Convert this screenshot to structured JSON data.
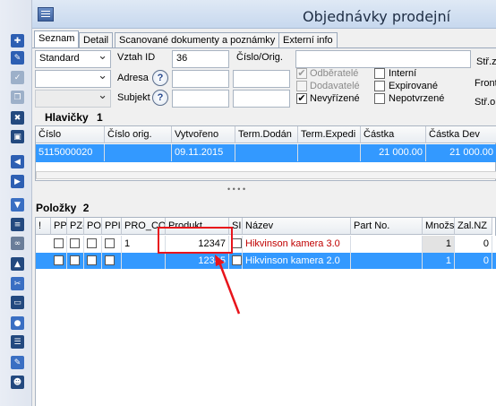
{
  "window": {
    "title": "Objednávky prodejní"
  },
  "toolbar": {
    "icons": [
      "add-record-icon",
      "edit-icon",
      "check-icon",
      "copy-icon",
      "delete-icon",
      "print-icon",
      "nav-first-icon",
      "nav-last-icon",
      "filter-icon",
      "list-icon",
      "link-icon",
      "lock-icon",
      "tool-icon",
      "monitor-icon",
      "settings-icon",
      "report-icon",
      "notes-icon",
      "people-icon"
    ]
  },
  "tabs": [
    {
      "label": "Seznam"
    },
    {
      "label": "Detail"
    },
    {
      "label": "Scanované dokumenty a poznámky"
    },
    {
      "label": "Externí info"
    }
  ],
  "filters": {
    "standard": "Standard",
    "vztah_label": "Vztah ID",
    "vztah_value": "36",
    "adresa_label": "Adresa",
    "subjekt_label": "Subjekt",
    "cislo_label": "Číslo/Orig.",
    "q": "?",
    "odberatele": "Odběratelé",
    "dodavatele": "Dodavatelé",
    "nevyrizene": "Nevyřízené",
    "interni": "Interní",
    "expirovane": "Expirované",
    "nepotvrzene": "Nepotvrzené",
    "right1": "Stř.zl",
    "right2": "Fronta",
    "right3": "Stř.ob",
    "check": "✔"
  },
  "headers_grid": {
    "title": "Hlavičky",
    "count": "1",
    "columns": [
      "Číslo",
      "Číslo orig.",
      "Vytvořeno",
      "Term.Dodán",
      "Term.Expedi",
      "Částka",
      "Částka Dev"
    ],
    "rows": [
      {
        "cislo": "5115000020",
        "orig": "",
        "vytvoreno": "09.11.2015",
        "dodan": "",
        "exped": "",
        "castka": "21 000.00",
        "castka_dev": "21 000.00"
      }
    ]
  },
  "items_grid": {
    "title": "Položky",
    "count": "2",
    "columns": [
      "!",
      "PP-",
      "PZ-",
      "PO",
      "PPI",
      "PRO_COD",
      "Produkt",
      "SI",
      "Název",
      "Part No.",
      "Množs",
      "Zal.NZ"
    ],
    "rows": [
      {
        "pro": "1",
        "produkt": "12347",
        "nazev": "Hikvinson kamera 3.0",
        "part": "",
        "mnoz": "1",
        "zal": "0"
      },
      {
        "pro": "",
        "produkt": "12345",
        "nazev": "Hikvinson kamera 2.0",
        "part": "",
        "mnoz": "1",
        "zal": "0"
      }
    ]
  },
  "colors": {
    "selection": "#3399ff",
    "highlight_red": "#e8141b",
    "name_red": "#c00000"
  }
}
